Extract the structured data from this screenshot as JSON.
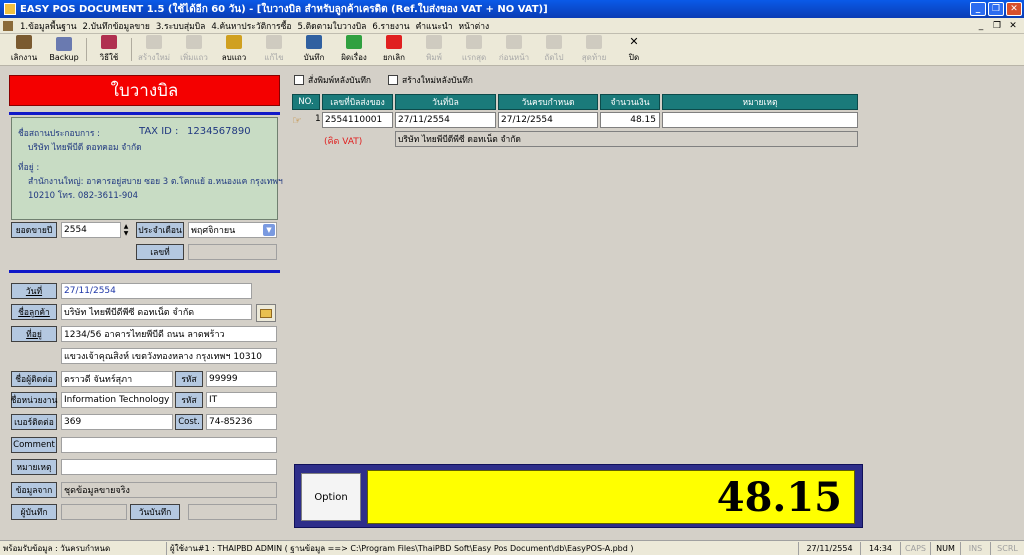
{
  "window": {
    "title": "EASY POS DOCUMENT 1.5 (ใช้ได้อีก 60 วัน) - [ใบวางบิล สำหรับลูกค้าเครดิต (Ref.ใบส่งของ VAT + NO VAT)]"
  },
  "menu": [
    "1.ข้อมูลพื้นฐาน",
    "2.บันทึกข้อมูลขาย",
    "3.ระบบสุ่มบิล",
    "4.ค้นหาประวัติการซื้อ",
    "5.ติดตามใบวางบิล",
    "6.รายงาน",
    "คำแนะนำ",
    "หน้าต่าง"
  ],
  "toolbar": [
    {
      "name": "exit-button",
      "label": "เลิกงาน",
      "icon": "door-icon",
      "enabled": true,
      "color": "#7a5a30"
    },
    {
      "name": "backup-button",
      "label": "Backup",
      "icon": "computer-icon",
      "enabled": true,
      "color": "#6a7ab0"
    },
    {
      "sep": true
    },
    {
      "name": "howto-button",
      "label": "วิธีใช้",
      "icon": "book-icon",
      "enabled": true,
      "color": "#b03050"
    },
    {
      "sep": true
    },
    {
      "name": "new-button",
      "label": "สร้างใหม่",
      "icon": "new-icon",
      "enabled": false
    },
    {
      "name": "add-row-button",
      "label": "เพิ่มแถว",
      "icon": "add-row-icon",
      "enabled": false
    },
    {
      "name": "delete-row-button",
      "label": "ลบแถว",
      "icon": "delete-row-icon",
      "enabled": true,
      "color": "#d0a020"
    },
    {
      "name": "edit-button",
      "label": "แก้ไข",
      "icon": "folder-icon",
      "enabled": false
    },
    {
      "name": "save-button",
      "label": "บันทึก",
      "icon": "save-icon",
      "enabled": true,
      "color": "#3060a0"
    },
    {
      "name": "add-document-button",
      "label": "ผิดเรื่อง",
      "icon": "plus-icon",
      "enabled": true,
      "color": "#30a040"
    },
    {
      "name": "cancel-button",
      "label": "ยกเลิก",
      "icon": "stop-icon",
      "enabled": true,
      "color": "#e02020"
    },
    {
      "name": "print-button",
      "label": "พิมพ์",
      "icon": "printer-icon",
      "enabled": false
    },
    {
      "name": "first-button",
      "label": "แรกสุด",
      "icon": "first-icon",
      "enabled": false
    },
    {
      "name": "prev-button",
      "label": "ก่อนหน้า",
      "icon": "prev-icon",
      "enabled": false
    },
    {
      "name": "next-button",
      "label": "ถัดไป",
      "icon": "next-icon",
      "enabled": false
    },
    {
      "name": "last-button",
      "label": "สุดท้าย",
      "icon": "last-icon",
      "enabled": false
    },
    {
      "name": "close-button",
      "label": "ปิด",
      "icon": "close-icon",
      "enabled": true,
      "glyph": "✕"
    }
  ],
  "left": {
    "heading": "ใบวางบิล",
    "company": {
      "name_label": "ชื่อสถานประกอบการ :",
      "taxid_label": "TAX ID :",
      "taxid": "1234567890",
      "name": "บริษัท ไทยพีบีดี ดอทคอม จำกัด",
      "address_label": "ที่อยู่ :",
      "address1": "สำนักงานใหญ่: อาคารอยู่สบาย ซอย 3 ต.โคกแย้ อ.หนองแค กรุงเทพฯ",
      "address2": "10210 โทร. 082-3611-904"
    },
    "year_label": "ยอดขายปี",
    "year": "2554",
    "month_label": "ประจำเดือน",
    "month": "พฤศจิกายน",
    "number_label": "เลขที่",
    "number": "",
    "date_label": "วันที่",
    "date": "27/11/2554",
    "customer_label": "ชื่อลูกค้า",
    "customer": "บริษัท ไทยพีบีดีพีซี ดอทเน็ต จำกัด",
    "address_label": "ที่อยู่",
    "address1": "1234/56 อาคารไทยพีบีดี ถนน ลาดพร้าว",
    "address2": "แขวงเจ้าคุณสิงห์ เขตวังทองหลาง กรุงเทพฯ 10310",
    "contact_label": "ชื่อผู้ติดต่อ",
    "contact": "ตราวดี จันทร์สุภา",
    "contact_code_label": "รหัส",
    "contact_code": "99999",
    "dept_label": "ชื่อหน่วยงาน",
    "dept": "Information Technology",
    "dept_code_label": "รหัส",
    "dept_code": "IT",
    "phone_label": "เบอร์ติดต่อ",
    "phone": "369",
    "cost_label": "Cost.",
    "cost": "74-85236",
    "comment_label": "Comment",
    "comment": "",
    "note_label": "หมายเหตุ",
    "note": "",
    "source_label": "ข้อมูลจาก",
    "source": "ชุดข้อมูลขายจริง",
    "recorder_label": "ผู้บันทึก",
    "recorder": "",
    "record_date_label": "วันบันทึก",
    "record_date": ""
  },
  "right": {
    "print_after_save": "สั่งพิมพ์หลังบันทึก",
    "new_after_save": "สร้างใหม่หลังบันทึก",
    "columns": [
      "NO.",
      "เลขที่บิลส่งของ",
      "วันที่บิล",
      "วันครบกำหนด",
      "จำนวนเงิน",
      "หมายเหตุ"
    ],
    "rows": [
      {
        "no": "1",
        "bill": "2554110001",
        "date": "27/11/2554",
        "due": "27/12/2554",
        "amount": "48.15",
        "note": ""
      }
    ],
    "vat_label": "(คิด VAT)",
    "vat_customer": "บริษัท ไทยพีบีดีพีซี ดอทเน็ต จำกัด",
    "option_label": "Option",
    "total": "48.15"
  },
  "status": {
    "left": "พร้อมรับข้อมูล : วันครบกำหนด",
    "path": "ผู้ใช้งาน#1 : THAIPBD  ADMIN ( ฐานข้อมูล ==> C:\\Program Files\\ThaiPBD Soft\\Easy Pos Document\\db\\EasyPOS-A.pbd )",
    "date": "27/11/2554",
    "time": "14:34",
    "caps": "CAPS",
    "num": "NUM",
    "ins": "INS",
    "scrl": "SCRL"
  }
}
